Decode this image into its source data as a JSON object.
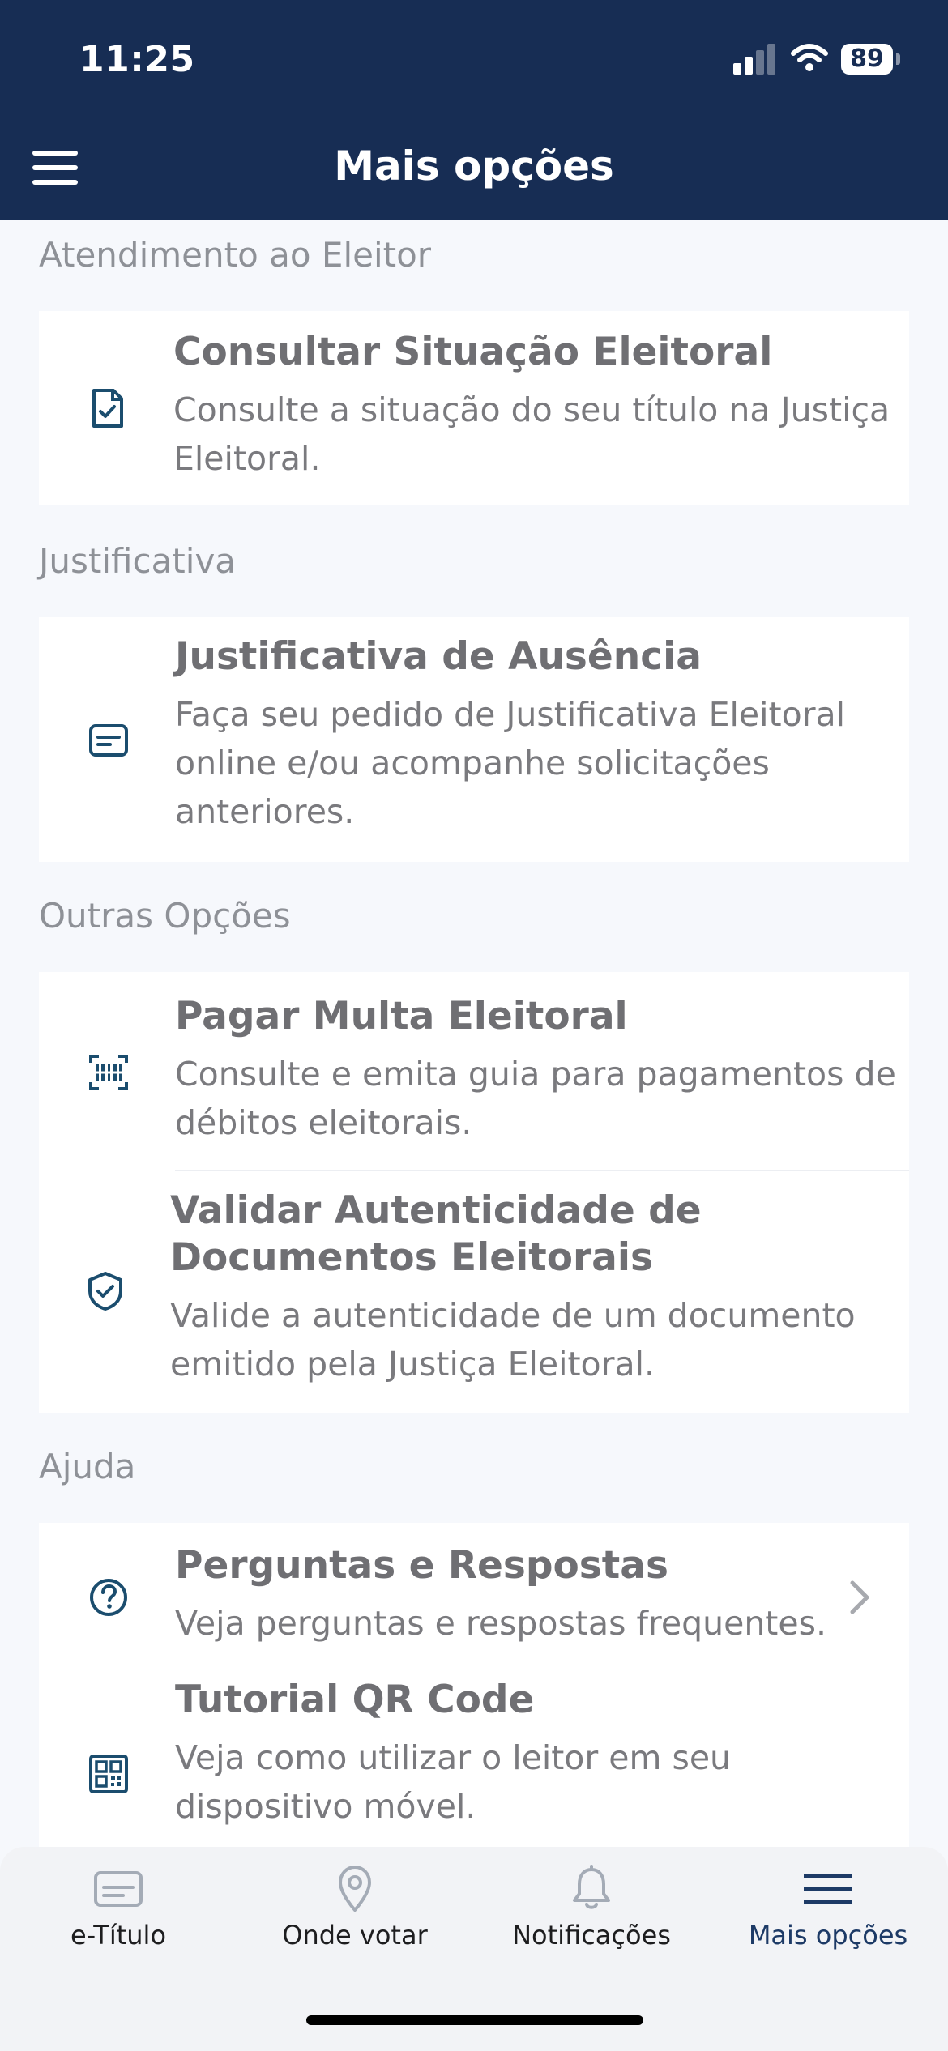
{
  "status_bar": {
    "time": "11:25",
    "battery": "89"
  },
  "header": {
    "title": "Mais opções"
  },
  "sections": [
    {
      "label": "Atendimento ao Eleitor",
      "items": [
        {
          "title": "Consultar Situação Eleitoral",
          "desc_lines": [
            "Consulte a situação do seu título na Justiça",
            "Eleitoral."
          ],
          "icon": "document-check-icon"
        }
      ]
    },
    {
      "label": "Justificativa",
      "items": [
        {
          "title": "Justificativa de Ausência",
          "desc_lines": [
            "Faça seu pedido de Justificativa Eleitoral",
            "online e/ou acompanhe solicitações",
            "anteriores."
          ],
          "icon": "message-icon"
        }
      ]
    },
    {
      "label": "Outras Opções",
      "items": [
        {
          "title": "Pagar Multa Eleitoral",
          "desc_lines": [
            "Consulte e emita guia para pagamentos de",
            "débitos eleitorais."
          ],
          "icon": "barcode-scan-icon"
        },
        {
          "title_lines": [
            "Validar Autenticidade de",
            "Documentos Eleitorais"
          ],
          "desc_lines": [
            "Valide a autenticidade de um documento",
            "emitido pela Justiça Eleitoral."
          ],
          "icon": "shield-check-icon"
        }
      ]
    },
    {
      "label": "Ajuda",
      "items": [
        {
          "title": "Perguntas e Respostas",
          "desc_lines": [
            "Veja perguntas e respostas frequentes."
          ],
          "icon": "question-circle-icon"
        },
        {
          "title": "Tutorial QR Code",
          "desc_lines": [
            "Veja como utilizar o leitor em seu",
            "dispositivo móvel."
          ],
          "icon": "qr-code-icon"
        }
      ]
    }
  ],
  "tabbar": {
    "tabs": [
      {
        "label": "e-Título",
        "icon": "id-card-icon"
      },
      {
        "label": "Onde votar",
        "icon": "map-pin-icon"
      },
      {
        "label": "Notificações",
        "icon": "bell-icon"
      },
      {
        "label": "Mais opções",
        "icon": "menu-icon",
        "active": true
      }
    ]
  },
  "colors": {
    "header_bg": "#172d54",
    "icon_accent": "#1b4d6e",
    "active_tab": "#1d3a66"
  }
}
